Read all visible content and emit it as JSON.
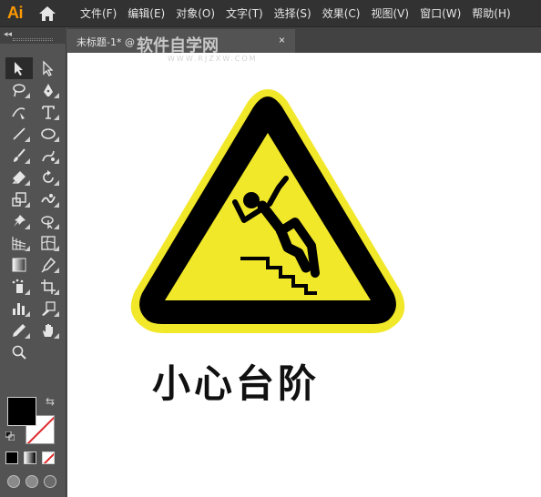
{
  "app": {
    "logo": "Ai"
  },
  "menu": [
    "文件(F)",
    "编辑(E)",
    "对象(O)",
    "文字(T)",
    "选择(S)",
    "效果(C)",
    "视图(V)",
    "窗口(W)",
    "帮助(H)"
  ],
  "document_tab": {
    "label": "未标题-1* @",
    "close": "×"
  },
  "watermark": {
    "title": "软件自学网",
    "url": "WWW.RJZXW.COM"
  },
  "toolbar": {
    "collapse": "◂◂",
    "tools": [
      "selection-tool",
      "direct-selection-tool",
      "magic-wand-tool",
      "pen-tool",
      "curvature-tool",
      "type-tool",
      "line-tool",
      "ellipse-tool",
      "paintbrush-tool",
      "blob-brush-tool",
      "eraser-tool",
      "rotate-tool",
      "scale-tool",
      "warp-tool",
      "puppet-warp-tool",
      "shape-builder-tool",
      "perspective-grid-tool",
      "mesh-tool",
      "gradient-tool",
      "eyedropper-tool",
      "symbol-sprayer-tool",
      "artboard-tool",
      "column-graph-tool",
      "slice-tool",
      "zoom-tool",
      "hand-tool",
      "zoom-tool"
    ],
    "fill_color": "#000000",
    "stroke_color": "none"
  },
  "artwork": {
    "caption": "小心台阶",
    "sign_yellow": "#f2e82a",
    "sign_black": "#000000"
  }
}
